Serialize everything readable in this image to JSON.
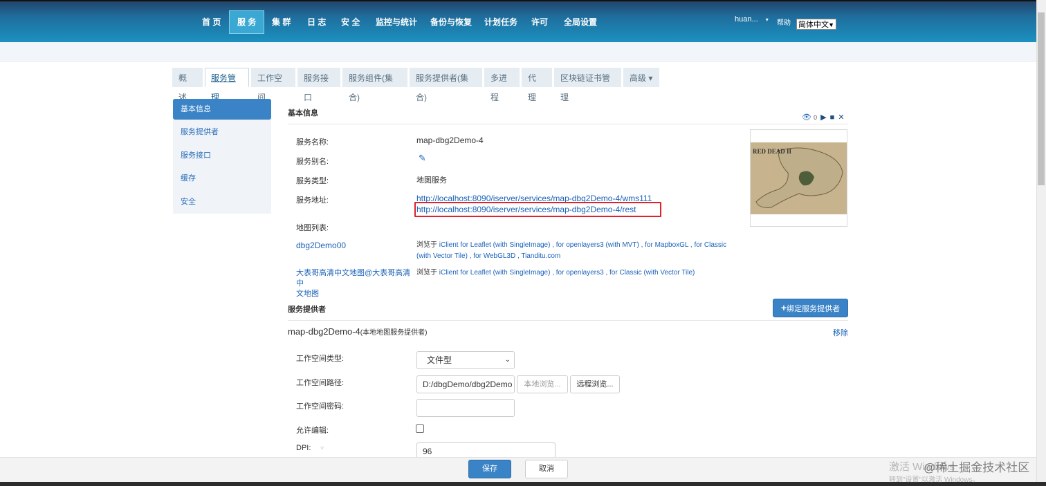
{
  "nav": {
    "items": [
      "首 页",
      "服 务",
      "集 群",
      "日 志",
      "安 全",
      "监控与统计",
      "备份与恢复",
      "计划任务",
      "许可",
      "全局设置"
    ],
    "active_index": 1
  },
  "header": {
    "user": "huan...",
    "user_caret": "▾",
    "help": "帮助",
    "language": "简体中文"
  },
  "tabs": [
    "概 述",
    "服务管理",
    "工作空间",
    "服务接口",
    "服务组件(集合)",
    "服务提供者(集合)",
    "多进程",
    "代 理",
    "区块链证书管理",
    "高级 ▾"
  ],
  "active_tab": 1,
  "sidebar": {
    "items": [
      "基本信息",
      "服务提供者",
      "服务接口",
      "缓存",
      "安全"
    ],
    "active_index": 0
  },
  "basic_info": {
    "title": "基本信息",
    "view_count": "0",
    "service_name_label": "服务名称:",
    "service_name": "map-dbg2Demo-4",
    "alias_label": "服务别名:",
    "type_label": "服务类型:",
    "type": "地图服务",
    "address_label": "服务地址:",
    "address_1": "http://localhost:8090/iserver/services/map-dbg2Demo-4/wms111",
    "address_2": "http://localhost:8090/iserver/services/map-dbg2Demo-4/rest",
    "map_list_label": "地图列表:",
    "maps": [
      {
        "name": "dbg2Demo00",
        "browse_prefix": "浏览于",
        "line1": "iClient for Leaflet (with SingleImage) , for openlayers3 (with MVT) , for MapboxGL , for Classic",
        "line2": "(with Vector Tile) , for WebGL3D , Tianditu.com"
      },
      {
        "name_line1": "大表哥高清中文地图@大表哥高清中",
        "name_line2": "文地图",
        "browse_prefix": "浏览于",
        "line1": "iClient for Leaflet (with SingleImage) , for openlayers3 , for Classic (with Vector Tile)"
      }
    ],
    "thumbnail_text": "RED DEAD II"
  },
  "provider": {
    "title": "服务提供者",
    "bind_button": "绑定服务提供者",
    "name": "map-dbg2Demo-4",
    "name_suffix": "(本地地图服务提供者)",
    "remove": "移除",
    "workspace_type_label": "工作空间类型:",
    "workspace_type": "文件型",
    "workspace_path_label": "工作空间路径:",
    "workspace_path": "D:/dbgDemo/dbg2Demo",
    "local_browse": "本地浏览...",
    "remote_browse": "远程浏览...",
    "workspace_password_label": "工作空间密码:",
    "allow_edit_label": "允许编辑:",
    "dpi_label": "DPI:",
    "dpi": "96"
  },
  "footer": {
    "save": "保存",
    "cancel": "取消"
  },
  "overlay": {
    "activate_text": "激活 Windows",
    "activate_sub": "转到\"设置\"以激活 Windows。",
    "credit": "@稀土掘金技术社区"
  }
}
